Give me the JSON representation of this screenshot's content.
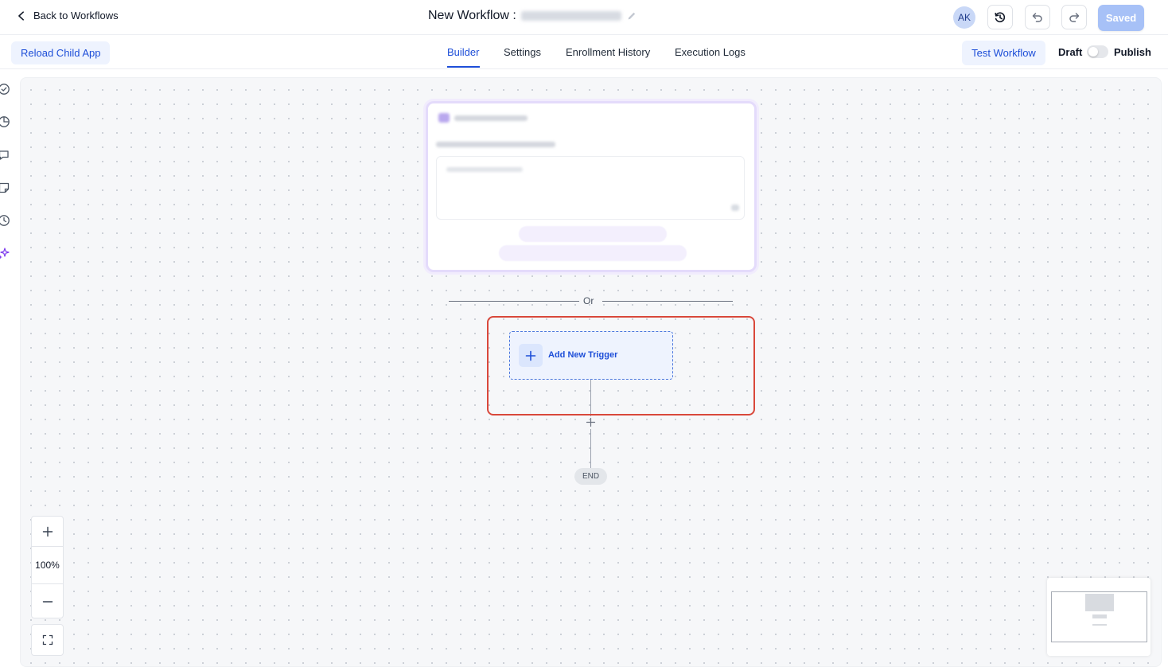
{
  "header": {
    "back_label": "Back to Workflows",
    "title": "New Workflow :",
    "avatar_initials": "AK",
    "saved_label": "Saved"
  },
  "subbar": {
    "reload_label": "Reload Child App",
    "tabs": [
      {
        "label": "Builder",
        "active": true
      },
      {
        "label": "Settings",
        "active": false
      },
      {
        "label": "Enrollment History",
        "active": false
      },
      {
        "label": "Execution Logs",
        "active": false
      }
    ],
    "test_label": "Test Workflow",
    "draft_label": "Draft",
    "publish_label": "Publish",
    "publish_toggle_on": false
  },
  "rail_icons": [
    "check-circle-icon",
    "pie-chart-icon",
    "comment-icon",
    "note-icon",
    "clock-icon",
    "sparkles-icon"
  ],
  "canvas": {
    "or_label": "Or",
    "trigger_label": "Add New Trigger",
    "end_label": "END",
    "zoom_level": "100%"
  },
  "colors": {
    "accent": "#1d4ed8",
    "accent_light": "#eef3fe",
    "highlight": "#d9483b",
    "ai_border": "#e4dbfb"
  }
}
